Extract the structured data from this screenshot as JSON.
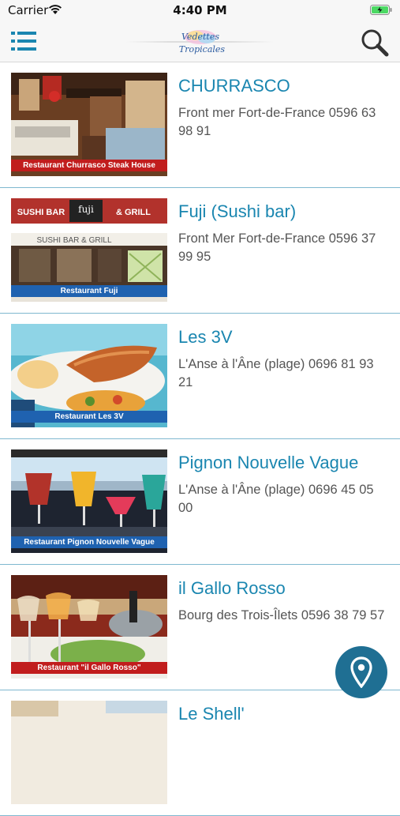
{
  "status": {
    "carrier": "Carrier",
    "time": "4:40 PM"
  },
  "header": {
    "logo_line1": "Vedettes",
    "logo_line2": "Tropicales"
  },
  "restaurants": [
    {
      "name": "CHURRASCO",
      "address": "Front mer Fort-de-France 0596 63 98 91",
      "caption": "Restaurant Churrasco Steak House"
    },
    {
      "name": "Fuji (Sushi bar)",
      "address": "Front Mer Fort-de-France 0596 37 99 95",
      "caption": "Restaurant Fuji",
      "sign_left": "SUSHI BAR",
      "sign_right": "& GRILL",
      "sign_logo": "fuji",
      "sign_awning": "SUSHI BAR & GRILL"
    },
    {
      "name": "Les 3V",
      "address": "L'Anse à l'Âne (plage)  0696 81 93 21",
      "caption": "Restaurant Les 3V"
    },
    {
      "name": "Pignon Nouvelle Vague",
      "address": "L'Anse à l'Âne (plage) 0696 45 05 00",
      "caption": "Restaurant Pignon Nouvelle Vague"
    },
    {
      "name": "il Gallo Rosso",
      "address": "Bourg des Trois-Îlets     0596 38 79 57",
      "caption": "Restaurant \"il Gallo Rosso\""
    },
    {
      "name": "Le Shell'",
      "address": "",
      "caption": ""
    }
  ],
  "icons": {
    "menu": "list-menu-icon",
    "search": "magnifier-icon",
    "fab": "map-pin-icon"
  },
  "colors": {
    "title": "#1a86b0",
    "divider": "#7fb8cf",
    "fab": "#1f6f93",
    "caption_red": "#c11d1d",
    "caption_blue": "#1f62b0"
  }
}
